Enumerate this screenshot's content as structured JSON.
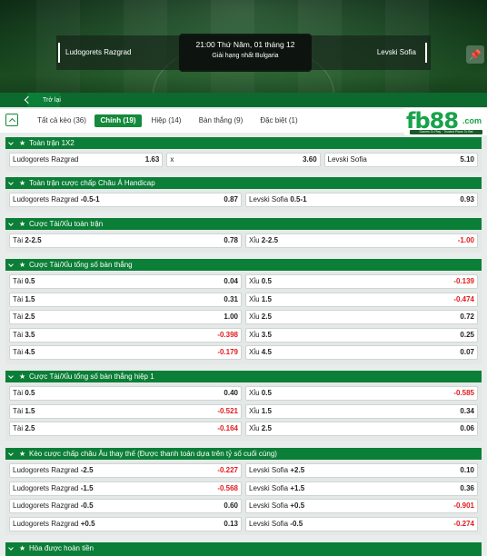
{
  "match": {
    "home": "Ludogorets Razgrad",
    "away": "Levski Sofia",
    "kickoff": "21:00 Thứ Năm, 01 tháng 12",
    "league": "Giải hạng nhất Bulgaria"
  },
  "back_label": "Trở lại",
  "tabs": [
    {
      "label": "Tất cả kèo (36)"
    },
    {
      "label": "Chính (19)",
      "active": true
    },
    {
      "label": "Hiệp (14)"
    },
    {
      "label": "Bàn thắng (9)"
    },
    {
      "label": "Đặc biệt (1)"
    }
  ],
  "logo": {
    "brand": "fb88",
    "suffix": ".com",
    "tagline": "Games To Play · Trusted Place To Bet"
  },
  "colors": {
    "accent": "#0b7e37",
    "negative": "#e01b1b"
  },
  "sections": [
    {
      "title": "Toàn trận 1X2",
      "rows": [
        [
          {
            "label": "Ludogorets Razgrad",
            "line": "",
            "odd": "1.63"
          },
          {
            "label": "x",
            "line": "",
            "odd": "3.60"
          },
          {
            "label": "Levski Sofia",
            "line": "",
            "odd": "5.10"
          }
        ]
      ]
    },
    {
      "title": "Toàn trận cược chấp Châu Á Handicap",
      "rows": [
        [
          {
            "label": "Ludogorets Razgrad",
            "line": "-0.5-1",
            "odd": "0.87"
          },
          {
            "label": "Levski Sofia",
            "line": "0.5-1",
            "odd": "0.93"
          }
        ]
      ]
    },
    {
      "title": "Cược Tài/Xỉu toàn trận",
      "rows": [
        [
          {
            "label": "Tài",
            "line": "2-2.5",
            "odd": "0.78"
          },
          {
            "label": "Xỉu",
            "line": "2-2.5",
            "odd": "-1.00"
          }
        ]
      ]
    },
    {
      "title": "Cược Tài/Xỉu tổng số bàn thắng",
      "rows": [
        [
          {
            "label": "Tài",
            "line": "0.5",
            "odd": "0.04"
          },
          {
            "label": "Xỉu",
            "line": "0.5",
            "odd": "-0.139"
          }
        ],
        [
          {
            "label": "Tài",
            "line": "1.5",
            "odd": "0.31"
          },
          {
            "label": "Xỉu",
            "line": "1.5",
            "odd": "-0.474"
          }
        ],
        [
          {
            "label": "Tài",
            "line": "2.5",
            "odd": "1.00"
          },
          {
            "label": "Xỉu",
            "line": "2.5",
            "odd": "0.72"
          }
        ],
        [
          {
            "label": "Tài",
            "line": "3.5",
            "odd": "-0.398"
          },
          {
            "label": "Xỉu",
            "line": "3.5",
            "odd": "0.25"
          }
        ],
        [
          {
            "label": "Tài",
            "line": "4.5",
            "odd": "-0.179"
          },
          {
            "label": "Xỉu",
            "line": "4.5",
            "odd": "0.07"
          }
        ]
      ]
    },
    {
      "title": "Cược Tài/Xỉu tổng số bàn thắng hiệp 1",
      "rows": [
        [
          {
            "label": "Tài",
            "line": "0.5",
            "odd": "0.40"
          },
          {
            "label": "Xỉu",
            "line": "0.5",
            "odd": "-0.585"
          }
        ],
        [
          {
            "label": "Tài",
            "line": "1.5",
            "odd": "-0.521"
          },
          {
            "label": "Xỉu",
            "line": "1.5",
            "odd": "0.34"
          }
        ],
        [
          {
            "label": "Tài",
            "line": "2.5",
            "odd": "-0.164"
          },
          {
            "label": "Xỉu",
            "line": "2.5",
            "odd": "0.06"
          }
        ]
      ]
    },
    {
      "title": "Kèo cược chấp châu Âu thay thế (Được thanh toán dựa trên tỷ số cuối cùng)",
      "rows": [
        [
          {
            "label": "Ludogorets Razgrad",
            "line": "-2.5",
            "odd": "-0.227"
          },
          {
            "label": "Levski Sofia",
            "line": "+2.5",
            "odd": "0.10"
          }
        ],
        [
          {
            "label": "Ludogorets Razgrad",
            "line": "-1.5",
            "odd": "-0.568"
          },
          {
            "label": "Levski Sofia",
            "line": "+1.5",
            "odd": "0.36"
          }
        ],
        [
          {
            "label": "Ludogorets Razgrad",
            "line": "-0.5",
            "odd": "0.60"
          },
          {
            "label": "Levski Sofia",
            "line": "+0.5",
            "odd": "-0.901"
          }
        ],
        [
          {
            "label": "Ludogorets Razgrad",
            "line": "+0.5",
            "odd": "0.13"
          },
          {
            "label": "Levski Sofia",
            "line": "-0.5",
            "odd": "-0.274"
          }
        ]
      ]
    },
    {
      "title": "Hòa được hoàn tiền",
      "rows": []
    }
  ]
}
